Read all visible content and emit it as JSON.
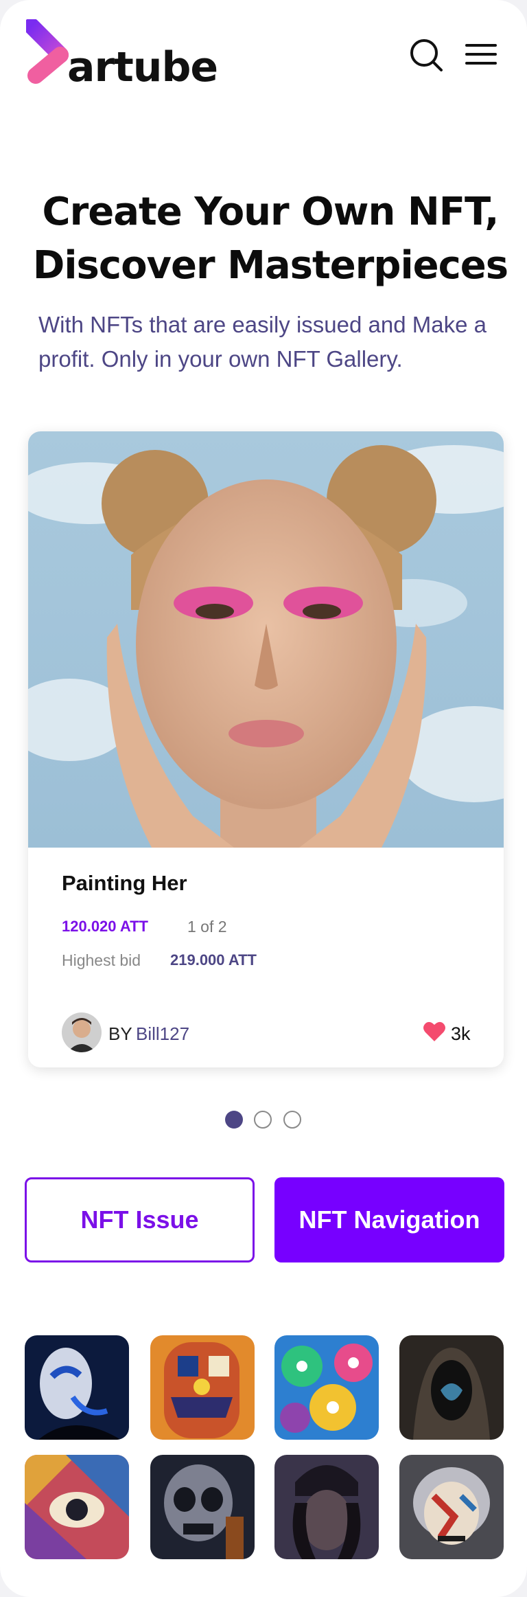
{
  "brand": {
    "name": "artube",
    "colors": {
      "purple": "#7700ff",
      "pink": "#f05fa0",
      "navy": "#4d4685"
    }
  },
  "header": {
    "search_icon": "search-icon",
    "menu_icon": "menu-icon"
  },
  "hero": {
    "title_line1": "Create Your Own NFT,",
    "title_line2": "Discover Masterpieces",
    "subtitle": "With NFTs that are easily issued and Make a profit. Only in your own NFT Gallery."
  },
  "featured": {
    "title": "Painting Her",
    "price": "120.020 ATT",
    "edition": "1 of 2",
    "highest_bid_label": "Highest bid",
    "highest_bid_value": "219.000 ATT",
    "by_label": "BY",
    "author": "Bill127",
    "likes": "3k"
  },
  "carousel": {
    "pages": 3,
    "active_index": 0
  },
  "actions": {
    "issue_label": "NFT Issue",
    "navigation_label": "NFT Navigation"
  },
  "gallery": {
    "items": 8
  }
}
